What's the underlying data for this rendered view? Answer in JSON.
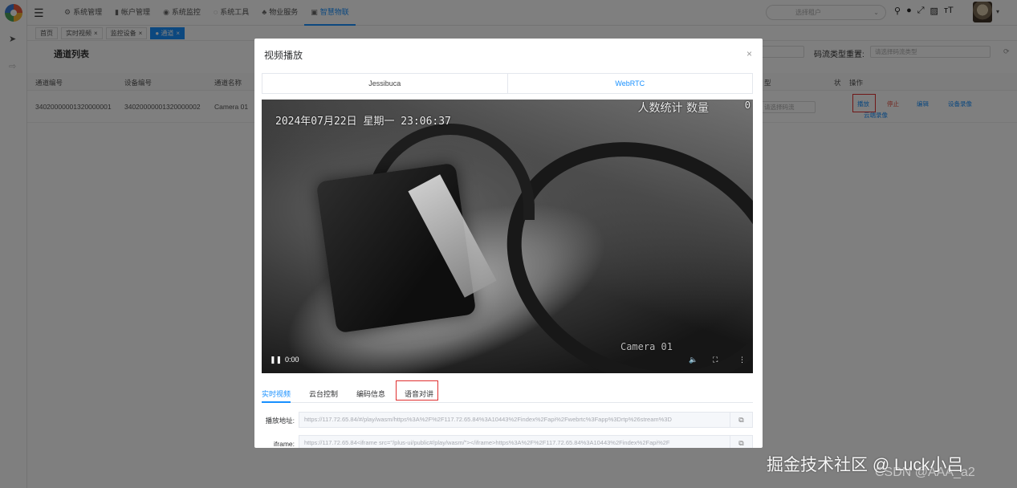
{
  "topbar": {
    "menu": [
      {
        "icon": "gear-icon",
        "glyph": "⚙",
        "label": "系统管理"
      },
      {
        "icon": "chart-icon",
        "glyph": "▮",
        "label": "帐户管理"
      },
      {
        "icon": "monitor-icon",
        "glyph": "◉",
        "label": "系统监控"
      },
      {
        "icon": "tool-icon",
        "glyph": "◌",
        "label": "系统工具"
      },
      {
        "icon": "tree-icon",
        "glyph": "♣",
        "label": "物业服务"
      },
      {
        "icon": "device-icon",
        "glyph": "▣",
        "label": "智慧物联"
      }
    ],
    "search_placeholder": "选择租户",
    "icons": [
      "search-icon",
      "github-icon",
      "fullscreen-icon",
      "doc-icon",
      "font-size-icon"
    ]
  },
  "tags": [
    {
      "label": "首页"
    },
    {
      "label": "实时视频",
      "close": "×"
    },
    {
      "label": "监控设备",
      "close": "×"
    },
    {
      "label": "通道",
      "close": "×",
      "active": true
    }
  ],
  "page": {
    "title": "通道列表",
    "filter_label": "码流类型重置:",
    "filter_placeholder": "请选择码流类型",
    "columns": [
      "通道编号",
      "设备编号",
      "通道名称",
      "型",
      "状",
      "操作"
    ],
    "row": {
      "channel_id": "34020000001320000001",
      "device_id": "34020000001320000002",
      "channel_name": "Camera 01",
      "select_placeholder": "请选择码流"
    },
    "operations": [
      "播放",
      "停止",
      "编辑",
      "设备录像",
      "云端录像"
    ]
  },
  "dialog": {
    "title": "视频播放",
    "close": "×",
    "player_tabs": [
      "Jessibuca",
      "WebRTC"
    ],
    "video": {
      "timestamp": "2024年07月22日  星期一  23:06:37",
      "count_label": "人数统计 数量",
      "count_value": "0",
      "camera_name": "Camera 01",
      "time": "0:00"
    },
    "sub_tabs": [
      "实时视频",
      "云台控制",
      "编码信息",
      "语音对讲"
    ],
    "fields": [
      {
        "label": "播放地址:",
        "value": "https://117.72.65.84/#/play/wasm/https%3A%2F%2F117.72.65.84%3A10443%2Findex%2Fapi%2Fwebrtc%3Fapp%3Drtp%26stream%3D"
      },
      {
        "label": "iframe:",
        "value": "https://117.72.65.84<iframe src=\"/plus-ui/public#/play/wasm/\"></iframe>https%3A%2F%2F117.72.65.84%3A10443%2Findex%2Fapi%2F"
      }
    ]
  },
  "watermark": "掘金技术社区 @ Luck小吕",
  "watermark_csdn": "CSDN @AAA_a2",
  "colors": {
    "accent": "#1890ff",
    "highlight": "#e02f2f",
    "overlay": "rgba(0,0,0,0.5)"
  }
}
